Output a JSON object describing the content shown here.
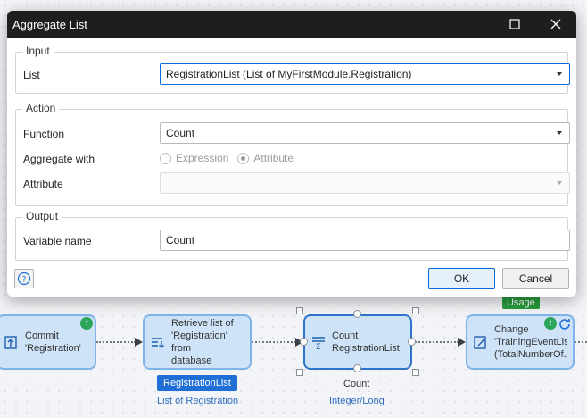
{
  "dialog": {
    "title": "Aggregate List",
    "input": {
      "legend": "Input",
      "list_label": "List",
      "list_value": "RegistrationList (List of MyFirstModule.Registration)"
    },
    "action": {
      "legend": "Action",
      "function_label": "Function",
      "function_value": "Count",
      "aggregate_with_label": "Aggregate with",
      "option_expression": "Expression",
      "option_attribute": "Attribute",
      "attribute_label": "Attribute",
      "attribute_value": ""
    },
    "output": {
      "legend": "Output",
      "variable_name_label": "Variable name",
      "variable_name_value": "Count"
    },
    "buttons": {
      "ok": "OK",
      "cancel": "Cancel"
    }
  },
  "canvas": {
    "activities": [
      {
        "label": "Commit\n'Registration'"
      },
      {
        "label": "Retrieve list of\n'Registration' from\ndatabase"
      },
      {
        "label": "Count\nRegistrationList"
      },
      {
        "label": "Change\n'TrainingEventList'\n(TotalNumberOf..."
      }
    ],
    "retrieve_output": {
      "name": "RegistrationList",
      "type": "List of Registration"
    },
    "count_output": {
      "name": "Count",
      "type": "Integer/Long"
    },
    "usage_badge": "Usage"
  },
  "colors": {
    "title_bar": "#1e1e1e",
    "focus_blue": "#0b69d8",
    "activity_fill": "#cfe3f8",
    "activity_border": "#7eb4ea",
    "variable_chip": "#1f6fd6",
    "usage_green": "#279b3c"
  },
  "icons": [
    "maximize-icon",
    "close-icon",
    "help-icon",
    "commit-icon",
    "retrieve-icon",
    "aggregate-icon",
    "change-object-icon",
    "dropdown-arrow-icon"
  ]
}
